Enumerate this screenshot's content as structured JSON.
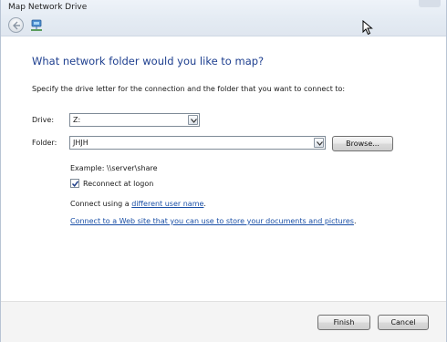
{
  "window": {
    "title": "Map Network Drive"
  },
  "nav": {
    "back_icon": "back-arrow-icon",
    "app_icon": "network-drive-icon"
  },
  "main": {
    "heading": "What network folder would you like to map?",
    "instructions": "Specify the drive letter for the connection and the folder that you want to connect to:",
    "drive": {
      "label": "Drive:",
      "value": "Z:"
    },
    "folder": {
      "label": "Folder:",
      "value": "JHJH"
    },
    "browse_label": "Browse...",
    "example": "Example: \\\\server\\share",
    "reconnect": {
      "label": "Reconnect at logon",
      "checked": true
    },
    "connect_prefix": "Connect using a ",
    "connect_link": "different user name",
    "connect_suffix": ".",
    "web_link": "Connect to a Web site that you can use to store your documents and pictures",
    "web_suffix": "."
  },
  "footer": {
    "finish_label": "Finish",
    "cancel_label": "Cancel"
  },
  "colors": {
    "heading": "#1e3f8f",
    "link": "#1a4fa6",
    "titlebar": "#e4ebf3"
  }
}
